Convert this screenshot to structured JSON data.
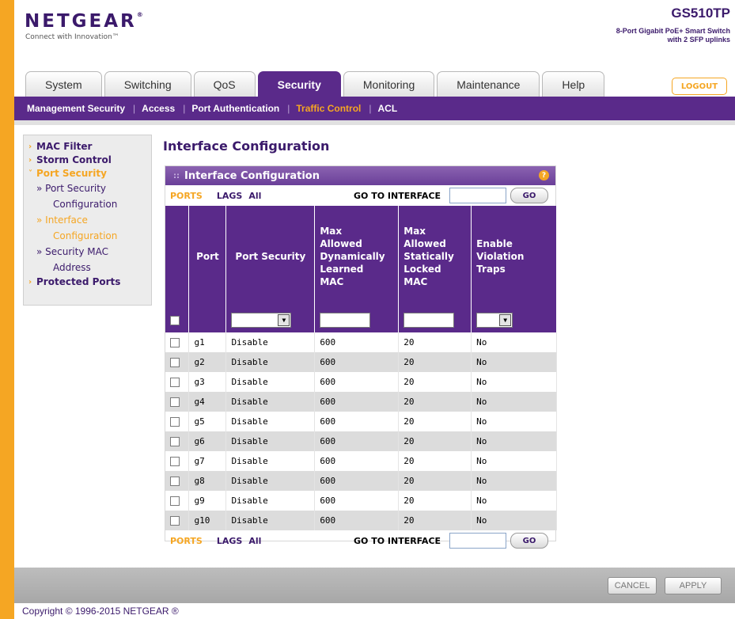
{
  "header": {
    "brand": "NETGEAR",
    "tagline": "Connect with Innovation™",
    "model": "GS510TP",
    "model_desc_1": "8-Port Gigabit PoE+ Smart Switch",
    "model_desc_2": "with 2 SFP uplinks",
    "logout": "LOGOUT"
  },
  "tabs": [
    {
      "label": "System"
    },
    {
      "label": "Switching"
    },
    {
      "label": "QoS"
    },
    {
      "label": "Security"
    },
    {
      "label": "Monitoring"
    },
    {
      "label": "Maintenance"
    },
    {
      "label": "Help"
    }
  ],
  "subnav": [
    {
      "label": "Management Security"
    },
    {
      "label": "Access"
    },
    {
      "label": "Port Authentication"
    },
    {
      "label": "Traffic Control"
    },
    {
      "label": "ACL"
    }
  ],
  "leftmenu": {
    "mac_filter": "MAC Filter",
    "storm_control": "Storm Control",
    "port_security": "Port Security",
    "sub1_a": "» Port Security",
    "sub1_b": "Configuration",
    "sub2_a": "» Interface",
    "sub2_b": "Configuration",
    "sub3_a": "» Security MAC",
    "sub3_b": "Address",
    "protected_ports": "Protected Ports"
  },
  "main": {
    "page_title": "Interface Configuration",
    "panel_title": "Interface Configuration",
    "help": "?",
    "filter": {
      "ports": "PORTS",
      "lags": "LAGS",
      "all": "All",
      "goto": "GO TO INTERFACE",
      "go": "GO"
    },
    "columns": {
      "port": "Port",
      "port_security": "Port Security",
      "max_dyn_1": "Max",
      "max_dyn_2": "Allowed",
      "max_dyn_3": "Dynamically",
      "max_dyn_4": "Learned",
      "max_dyn_5": "MAC",
      "max_stat_1": "Max",
      "max_stat_2": "Allowed",
      "max_stat_3": "Statically",
      "max_stat_4": "Locked",
      "max_stat_5": "MAC",
      "traps_1": "Enable",
      "traps_2": "Violation",
      "traps_3": "Traps"
    },
    "rows": [
      {
        "port": "g1",
        "security": "Disable",
        "dyn": "600",
        "stat": "20",
        "traps": "No"
      },
      {
        "port": "g2",
        "security": "Disable",
        "dyn": "600",
        "stat": "20",
        "traps": "No"
      },
      {
        "port": "g3",
        "security": "Disable",
        "dyn": "600",
        "stat": "20",
        "traps": "No"
      },
      {
        "port": "g4",
        "security": "Disable",
        "dyn": "600",
        "stat": "20",
        "traps": "No"
      },
      {
        "port": "g5",
        "security": "Disable",
        "dyn": "600",
        "stat": "20",
        "traps": "No"
      },
      {
        "port": "g6",
        "security": "Disable",
        "dyn": "600",
        "stat": "20",
        "traps": "No"
      },
      {
        "port": "g7",
        "security": "Disable",
        "dyn": "600",
        "stat": "20",
        "traps": "No"
      },
      {
        "port": "g8",
        "security": "Disable",
        "dyn": "600",
        "stat": "20",
        "traps": "No"
      },
      {
        "port": "g9",
        "security": "Disable",
        "dyn": "600",
        "stat": "20",
        "traps": "No"
      },
      {
        "port": "g10",
        "security": "Disable",
        "dyn": "600",
        "stat": "20",
        "traps": "No"
      }
    ]
  },
  "footer": {
    "cancel": "CANCEL",
    "apply": "APPLY",
    "copyright": "Copyright © 1996-2015 NETGEAR ®"
  },
  "colors": {
    "purple": "#5a2a8a",
    "orange": "#f5a623",
    "dark_purple": "#3b1a6b"
  }
}
